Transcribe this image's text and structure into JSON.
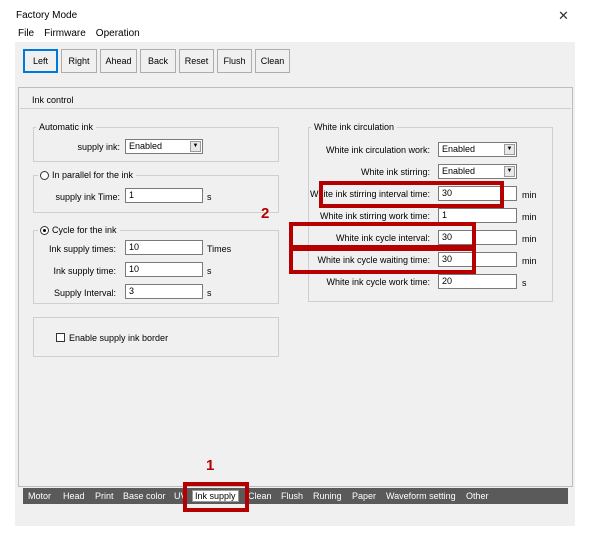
{
  "window": {
    "title": "Factory Mode",
    "close": "✕"
  },
  "menu": [
    "File",
    "Firmware",
    "Operation"
  ],
  "toolbar": [
    "Left",
    "Right",
    "Ahead",
    "Back",
    "Reset",
    "Flush",
    "Clean"
  ],
  "panel": {
    "title": "Ink control"
  },
  "automatic_ink": {
    "label": "Automatic ink",
    "supply_ink_label": "supply ink:",
    "supply_ink_value": "Enabled"
  },
  "parallel": {
    "label": "In parallel for the ink",
    "time_label": "supply ink Time:",
    "time_value": "1",
    "time_unit": "s"
  },
  "cycle": {
    "label": "Cycle for the ink",
    "times_label": "Ink supply times:",
    "times_value": "10",
    "times_unit": "Times",
    "time_label": "Ink supply time:",
    "time_value": "10",
    "time_unit": "s",
    "interval_label": "Supply Interval:",
    "interval_value": "3",
    "interval_unit": "s"
  },
  "border": {
    "label": "Enable supply ink border"
  },
  "white": {
    "label": "White ink circulation",
    "work_label": "White ink circulation work:",
    "work_value": "Enabled",
    "stirring_label": "White ink stirring:",
    "stirring_value": "Enabled",
    "stir_interval_label": "White ink stirring interval time:",
    "stir_interval_value": "30",
    "stir_interval_unit": "min",
    "stir_work_label": "White ink stirring work time:",
    "stir_work_value": "1",
    "stir_work_unit": "min",
    "cycle_interval_label": "White ink cycle interval:",
    "cycle_interval_value": "30",
    "cycle_interval_unit": "min",
    "cycle_wait_label": "White ink cycle waiting time:",
    "cycle_wait_value": "30",
    "cycle_wait_unit": "min",
    "cycle_work_label": "White ink cycle work time:",
    "cycle_work_value": "20",
    "cycle_work_unit": "s"
  },
  "bottom_tabs": [
    "Motor",
    "Head",
    "Print",
    "Base color",
    "UV",
    "Ink supply",
    "Clean",
    "Flush",
    "Runing",
    "Paper",
    "Waveform setting",
    "Other"
  ],
  "annotations": {
    "one": "1",
    "two": "2"
  },
  "colors": {
    "highlight": "#b40000",
    "tabbar": "#5a5a5a"
  }
}
